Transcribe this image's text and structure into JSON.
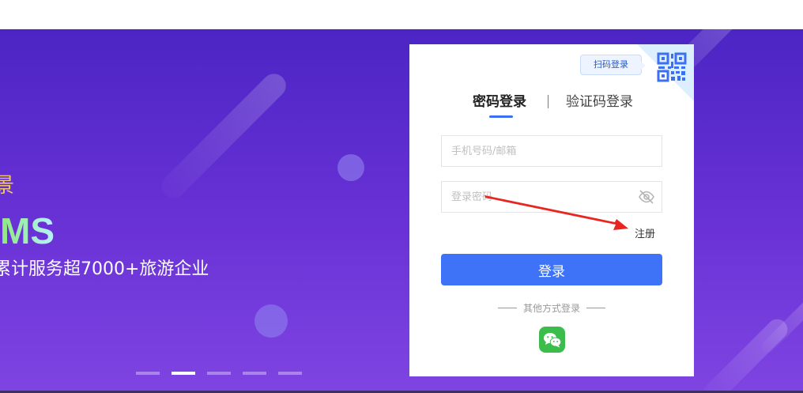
{
  "hero": {
    "line1": "景",
    "line2": "MS",
    "line3": "累计服务超7000+旅游企业",
    "slides": [
      {
        "active": false
      },
      {
        "active": true
      },
      {
        "active": false
      },
      {
        "active": false
      },
      {
        "active": false
      }
    ]
  },
  "login": {
    "scan_tip": "扫码登录",
    "tab_password": "密码登录",
    "tab_sms": "验证码登录",
    "phone_placeholder": "手机号码/邮箱",
    "password_placeholder": "登录密码",
    "register": "注册",
    "submit": "登录",
    "other_methods": "其他方式登录"
  },
  "icons": {
    "qr": "qr-code-icon",
    "eye": "eye-hidden-icon",
    "wechat": "wechat-icon"
  },
  "colors": {
    "primary": "#3f73f7",
    "hero_start": "#4c25c4",
    "hero_end": "#7f45e2",
    "accent_gold": "#f3c56a",
    "wechat_green": "#3bbd4c",
    "annotation_arrow": "#e8261f"
  }
}
